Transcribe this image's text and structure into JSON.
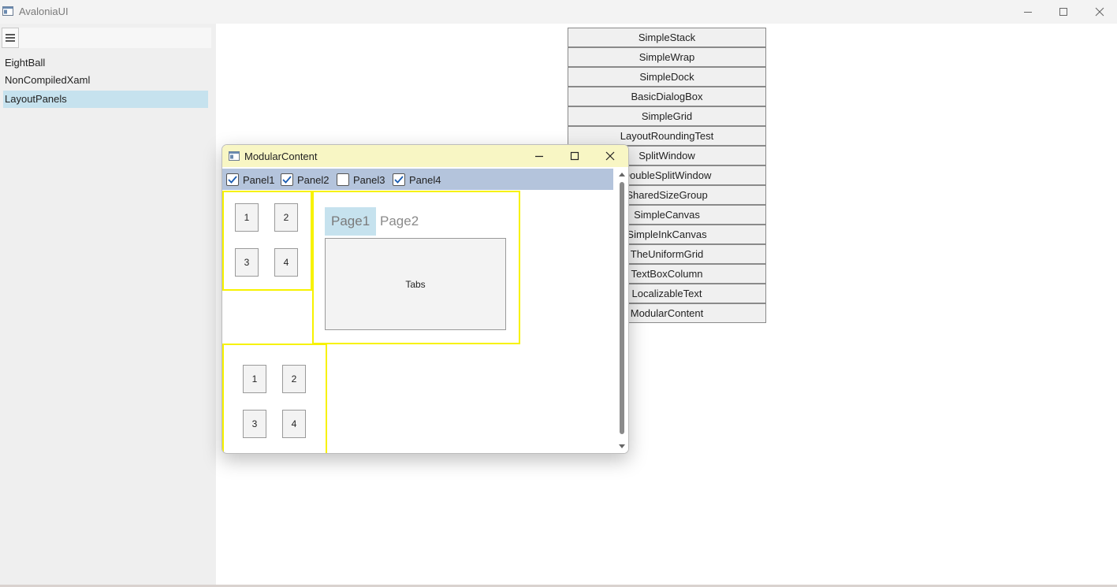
{
  "app": {
    "title": "AvaloniaUI",
    "caption_buttons": [
      "minimize-icon",
      "maximize-icon",
      "close-icon"
    ]
  },
  "sidebar": {
    "menu_icon": "hamburger-icon",
    "items": [
      {
        "label": "EightBall",
        "selected": false
      },
      {
        "label": "NonCompiledXaml",
        "selected": false
      },
      {
        "label": "LayoutPanels",
        "selected": true
      }
    ]
  },
  "layout_panels": {
    "buttons": [
      "SimpleStack",
      "SimpleWrap",
      "SimpleDock",
      "BasicDialogBox",
      "SimpleGrid",
      "LayoutRoundingTest",
      "SplitWindow",
      "DoubleSplitWindow",
      "SharedSizeGroup",
      "SimpleCanvas",
      "SimpleInkCanvas",
      "TheUniformGrid",
      "TextBoxColumn",
      "LocalizableText",
      "ModularContent"
    ]
  },
  "child_window": {
    "title": "ModularContent",
    "titlebar_color": "#f8f6c4",
    "checkbox_bar_color": "#b4c4dc",
    "panel_border_color": "#f7f200",
    "checkboxes": [
      {
        "label": "Panel1",
        "checked": true
      },
      {
        "label": "Panel2",
        "checked": true
      },
      {
        "label": "Panel3",
        "checked": false
      },
      {
        "label": "Panel4",
        "checked": true
      }
    ],
    "panel1_buttons": [
      "1",
      "2",
      "3",
      "4"
    ],
    "panel4_buttons": [
      "1",
      "2",
      "3",
      "4"
    ],
    "tabs": [
      {
        "label": "Page1",
        "active": true
      },
      {
        "label": "Page2",
        "active": false
      }
    ],
    "tab_content": "Tabs"
  }
}
